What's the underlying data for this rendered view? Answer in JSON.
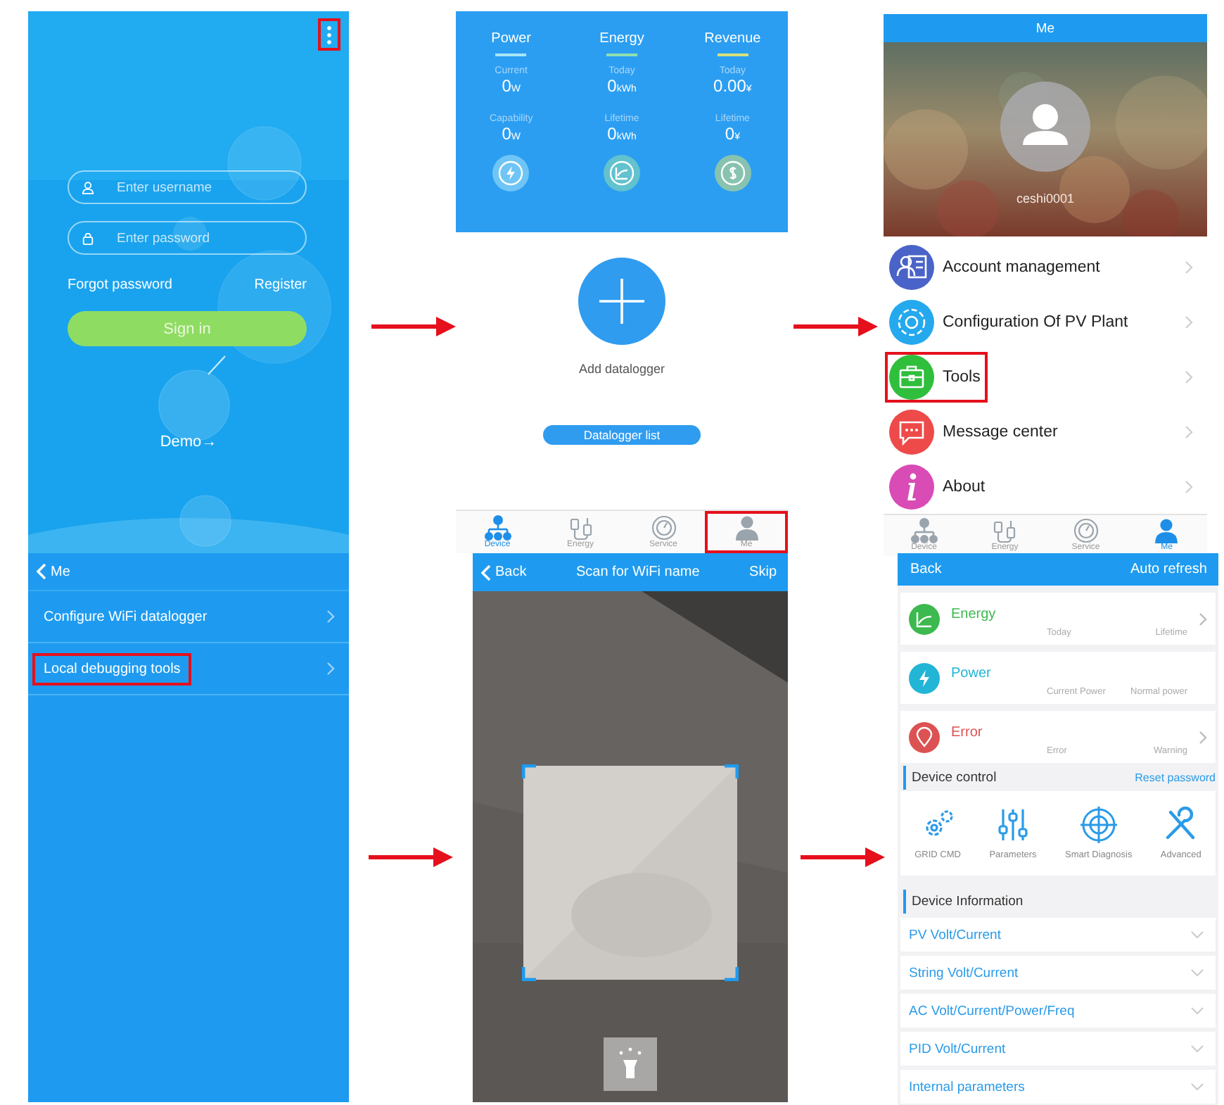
{
  "screens": [
    {
      "kind": "login",
      "menu_highlighted": true,
      "username": {
        "placeholder": "Enter username"
      },
      "password": {
        "placeholder": "Enter password"
      },
      "forgot": "Forgot password",
      "register": "Register",
      "sign_in": "Sign in",
      "demo": "Demo→"
    },
    {
      "kind": "dashboard",
      "stats": [
        {
          "title": "Power",
          "color": "#a8e6f7",
          "metrics": [
            {
              "label": "Current",
              "value": "0",
              "unit": "W"
            },
            {
              "label": "Capability",
              "value": "0",
              "unit": "W"
            }
          ]
        },
        {
          "title": "Energy",
          "color": "#8fe0b0",
          "metrics": [
            {
              "label": "Today",
              "value": "0",
              "unit": "kWh"
            },
            {
              "label": "Lifetime",
              "value": "0",
              "unit": "kWh"
            }
          ]
        },
        {
          "title": "Revenue",
          "color": "#d6e27a",
          "metrics": [
            {
              "label": "Today",
              "value": "0.00",
              "unit": "¥"
            },
            {
              "label": "Lifetime",
              "value": "0",
              "unit": "¥"
            }
          ]
        }
      ],
      "add": "Add datalogger",
      "list_button": "Datalogger list",
      "tabs": [
        {
          "label": "Device",
          "selected": true,
          "highlighted": false
        },
        {
          "label": "Energy",
          "selected": false,
          "highlighted": false
        },
        {
          "label": "Service",
          "selected": false,
          "highlighted": false
        },
        {
          "label": "Me",
          "selected": false,
          "highlighted": true
        }
      ]
    },
    {
      "kind": "me",
      "title": "Me",
      "username": "ceshi0001",
      "items": [
        {
          "label": "Account management",
          "color": "#4a63c8",
          "highlighted": false
        },
        {
          "label": "Configuration Of PV Plant",
          "color": "#25a9ee",
          "highlighted": false
        },
        {
          "label": "Tools",
          "color": "#2fbf3c",
          "highlighted": true
        },
        {
          "label": "Message center",
          "color": "#ee4a4a",
          "highlighted": false
        },
        {
          "label": "About",
          "color": "#d94bb5",
          "highlighted": false
        }
      ],
      "tabs": [
        {
          "label": "Device",
          "selected": false,
          "highlighted": false
        },
        {
          "label": "Energy",
          "selected": false,
          "highlighted": false
        },
        {
          "label": "Service",
          "selected": false,
          "highlighted": false
        },
        {
          "label": "Me",
          "selected": true,
          "highlighted": false
        }
      ]
    },
    {
      "kind": "tools",
      "back": "Me",
      "items": [
        {
          "label": "Configure WiFi datalogger",
          "highlighted": false
        },
        {
          "label": "Local debugging tools",
          "highlighted": true
        }
      ]
    },
    {
      "kind": "scan",
      "back": "Back",
      "title": "Scan for WiFi name",
      "skip": "Skip"
    },
    {
      "kind": "device",
      "back": "Back",
      "refresh": "Auto refresh",
      "cards": [
        {
          "title": "Energy",
          "color": "#3cb94f",
          "labels": [
            "Today",
            "Lifetime"
          ],
          "chevron": true
        },
        {
          "title": "Power",
          "color": "#22b5d6",
          "labels": [
            "Current Power",
            "Normal power"
          ],
          "chevron": false
        },
        {
          "title": "Error",
          "color": "#dc5252",
          "labels": [
            "Error",
            "Warning"
          ],
          "chevron": true
        }
      ],
      "control": {
        "title": "Device control",
        "link": "Reset password",
        "tools": [
          "GRID CMD",
          "Parameters",
          "Smart Diagnosis",
          "Advanced"
        ]
      },
      "info": {
        "title": "Device Information",
        "rows": [
          "PV Volt/Current",
          "String Volt/Current",
          "AC Volt/Current/Power/Freq",
          "PID Volt/Current",
          "Internal parameters"
        ]
      }
    }
  ]
}
